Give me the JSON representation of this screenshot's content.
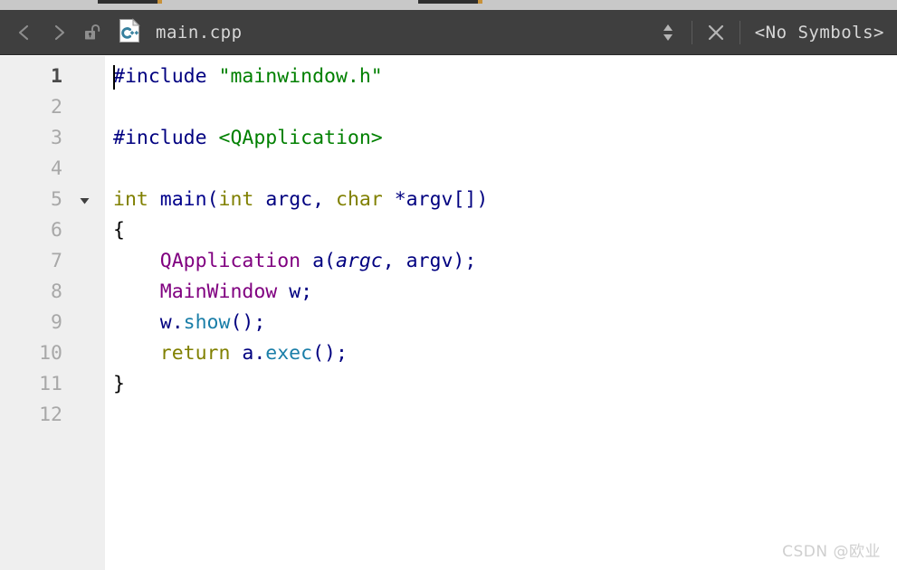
{
  "window": {
    "background_color": "#ffffff"
  },
  "top_strip": {
    "background_color": "#c8c8c8",
    "accent_color": "#c8923a"
  },
  "toolbar": {
    "background_color": "#3f3f3f",
    "text_color": "#d7d7d7",
    "back_icon": "chevron-left-icon",
    "forward_icon": "chevron-right-icon",
    "lock_icon": "unlocked-padlock-icon",
    "file_type_icon": "cpp-file-icon",
    "file_type_icon_label": "C++",
    "file_name": "main.cpp",
    "splitter_icon": "up-down-arrows-icon",
    "close_icon": "close-x-icon",
    "symbols_label": "<No Symbols>"
  },
  "editor": {
    "gutter_background": "#efefef",
    "code_background": "#ffffff",
    "line_number_color": "#a8a8a8",
    "current_line_number_color": "#4a4a4a",
    "current_line": 1,
    "fold_marker_line": 5,
    "fold_marker_icon": "triangle-down-icon",
    "cursor_line": 1,
    "cursor_column": 1,
    "line_numbers": [
      "1",
      "2",
      "3",
      "4",
      "5",
      "6",
      "7",
      "8",
      "9",
      "10",
      "11",
      "12"
    ],
    "lines": [
      {
        "n": "1",
        "tokens": [
          {
            "t": "#include",
            "c": "pre"
          },
          {
            "t": " ",
            "c": "plain"
          },
          {
            "t": "\"mainwindow.h\"",
            "c": "str"
          }
        ]
      },
      {
        "n": "2",
        "tokens": []
      },
      {
        "n": "3",
        "tokens": [
          {
            "t": "#include",
            "c": "pre"
          },
          {
            "t": " ",
            "c": "plain"
          },
          {
            "t": "<QApplication>",
            "c": "str"
          }
        ]
      },
      {
        "n": "4",
        "tokens": []
      },
      {
        "n": "5",
        "tokens": [
          {
            "t": "int",
            "c": "kw"
          },
          {
            "t": " ",
            "c": "plain"
          },
          {
            "t": "main",
            "c": "fn"
          },
          {
            "t": "(",
            "c": "plain"
          },
          {
            "t": "int",
            "c": "kw"
          },
          {
            "t": " ",
            "c": "plain"
          },
          {
            "t": "argc",
            "c": "plain"
          },
          {
            "t": ", ",
            "c": "plain"
          },
          {
            "t": "char",
            "c": "kw"
          },
          {
            "t": " ",
            "c": "plain"
          },
          {
            "t": "*argv[])",
            "c": "plain"
          }
        ]
      },
      {
        "n": "6",
        "tokens": [
          {
            "t": "{",
            "c": "brace"
          }
        ]
      },
      {
        "n": "7",
        "tokens": [
          {
            "t": "    ",
            "c": "plain"
          },
          {
            "t": "QApplication",
            "c": "type"
          },
          {
            "t": " ",
            "c": "plain"
          },
          {
            "t": "a(",
            "c": "plain"
          },
          {
            "t": "argc",
            "c": "param"
          },
          {
            "t": ", ",
            "c": "plain"
          },
          {
            "t": "argv);",
            "c": "plain"
          }
        ]
      },
      {
        "n": "8",
        "tokens": [
          {
            "t": "    ",
            "c": "plain"
          },
          {
            "t": "MainWindow",
            "c": "type"
          },
          {
            "t": " ",
            "c": "plain"
          },
          {
            "t": "w;",
            "c": "plain"
          }
        ]
      },
      {
        "n": "9",
        "tokens": [
          {
            "t": "    ",
            "c": "plain"
          },
          {
            "t": "w.",
            "c": "plain"
          },
          {
            "t": "show",
            "c": "call"
          },
          {
            "t": "();",
            "c": "plain"
          }
        ]
      },
      {
        "n": "10",
        "tokens": [
          {
            "t": "    ",
            "c": "plain"
          },
          {
            "t": "return",
            "c": "kw"
          },
          {
            "t": " ",
            "c": "plain"
          },
          {
            "t": "a.",
            "c": "plain"
          },
          {
            "t": "exec",
            "c": "call"
          },
          {
            "t": "();",
            "c": "plain"
          }
        ]
      },
      {
        "n": "11",
        "tokens": [
          {
            "t": "}",
            "c": "brace"
          }
        ]
      },
      {
        "n": "12",
        "tokens": []
      }
    ],
    "syntax_colors": {
      "preprocessor": "#000080",
      "string": "#008000",
      "keyword": "#808000",
      "type": "#800080",
      "function": "#00008b",
      "member_call": "#1a7ea8",
      "plain": "#000080",
      "brace": "#000000"
    }
  },
  "watermark": {
    "text": "CSDN @欧业"
  }
}
